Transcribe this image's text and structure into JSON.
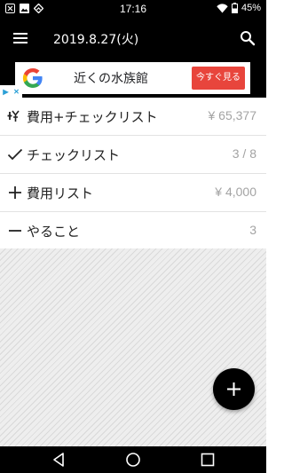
{
  "status_bar": {
    "time": "17:16",
    "battery": "45%",
    "icons_left": [
      "notification-x-icon",
      "image-icon",
      "feedly-icon"
    ],
    "icons_right": [
      "wifi-icon",
      "battery-icon"
    ]
  },
  "app_bar": {
    "title": "2019.8.27(火)",
    "icons": [
      "menu-icon",
      "search-icon"
    ]
  },
  "ad": {
    "text": "近くの水族館",
    "cta": "今すぐ見る",
    "logo": "google-g-logo"
  },
  "list": {
    "items": [
      {
        "icon": "yen-plus-icon",
        "label": "費用+チェックリスト",
        "value": "¥ 65,377"
      },
      {
        "icon": "check-icon",
        "label": "チェックリスト",
        "value": "3 / 8"
      },
      {
        "icon": "plus-icon",
        "label": "費用リスト",
        "value": "¥ 4,000"
      },
      {
        "icon": "minus-icon",
        "label": "やること",
        "value": "3"
      }
    ]
  },
  "fab": {
    "icon": "plus-icon"
  },
  "nav_bar": {
    "icons": [
      "back-icon",
      "home-icon",
      "recents-icon"
    ]
  },
  "colors": {
    "bar": "#000000",
    "ad_cta": "#e8453c",
    "value_text": "#a3a3a3",
    "pattern_bg": "#eeeeee"
  }
}
